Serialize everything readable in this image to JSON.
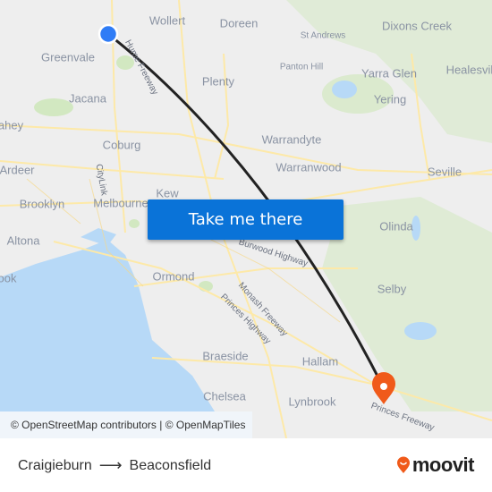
{
  "map": {
    "places": [
      {
        "name": "Wollert",
        "size": "normal"
      },
      {
        "name": "Doreen",
        "size": "normal"
      },
      {
        "name": "Dixons Creek",
        "size": "normal"
      },
      {
        "name": "St Andrews",
        "size": "small"
      },
      {
        "name": "Greenvale",
        "size": "normal"
      },
      {
        "name": "Panton Hill",
        "size": "small"
      },
      {
        "name": "Yarra Glen",
        "size": "normal"
      },
      {
        "name": "Healesville",
        "size": "normal"
      },
      {
        "name": "Jacana",
        "size": "normal"
      },
      {
        "name": "Plenty",
        "size": "normal"
      },
      {
        "name": "Yering",
        "size": "normal"
      },
      {
        "name": "ahey",
        "size": "normal"
      },
      {
        "name": "Coburg",
        "size": "normal"
      },
      {
        "name": "Warrandyte",
        "size": "normal"
      },
      {
        "name": "Ardeer",
        "size": "normal"
      },
      {
        "name": "Warranwood",
        "size": "normal"
      },
      {
        "name": "Seville",
        "size": "normal"
      },
      {
        "name": "Kew",
        "size": "normal"
      },
      {
        "name": "Brooklyn",
        "size": "normal"
      },
      {
        "name": "Melbourne",
        "size": "normal"
      },
      {
        "name": "Olinda",
        "size": "normal"
      },
      {
        "name": "Altona",
        "size": "normal"
      },
      {
        "name": "ook",
        "size": "normal"
      },
      {
        "name": "Ormond",
        "size": "normal"
      },
      {
        "name": "Selby",
        "size": "normal"
      },
      {
        "name": "Braeside",
        "size": "normal"
      },
      {
        "name": "Hallam",
        "size": "normal"
      },
      {
        "name": "Chelsea",
        "size": "normal"
      },
      {
        "name": "Lynbrook",
        "size": "normal"
      }
    ],
    "roads": [
      "Hume Freeway",
      "CityLink",
      "Burwood Highway",
      "Monash Freeway",
      "Princes Highway",
      "Princes Freeway"
    ],
    "origin_marker": "origin-dot",
    "destination_marker": "destination-pin",
    "colors": {
      "route": "#222222",
      "origin": "#2f7cf6",
      "destination": "#f05a1a",
      "water": "#b7d9f7",
      "park": "#c9e6b0",
      "road": "#fde9a8"
    }
  },
  "cta": {
    "label": "Take me there"
  },
  "attribution": "© OpenStreetMap contributors | © OpenMapTiles",
  "footer": {
    "origin": "Craigieburn",
    "arrow": "⟶",
    "destination": "Beaconsfield",
    "brand": "moovit",
    "brand_color": "#f05a1a"
  }
}
